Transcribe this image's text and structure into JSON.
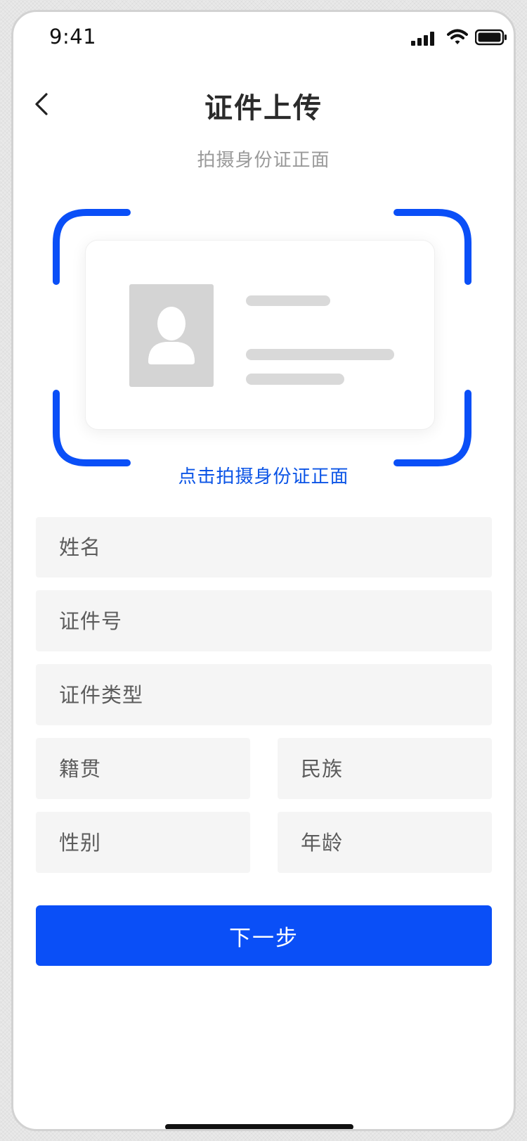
{
  "status_bar": {
    "time": "9:41"
  },
  "header": {
    "title": "证件上传",
    "subtitle": "拍摄身份证正面"
  },
  "scan": {
    "caption": "点击拍摄身份证正面"
  },
  "form": {
    "name_placeholder": "姓名",
    "id_number_placeholder": "证件号",
    "id_type_placeholder": "证件类型",
    "native_place_placeholder": "籍贯",
    "ethnicity_placeholder": "民族",
    "gender_placeholder": "性别",
    "age_placeholder": "年龄"
  },
  "actions": {
    "next_label": "下一步"
  },
  "colors": {
    "accent": "#0a4ff7",
    "caption_blue": "#0b54e6",
    "field_bg": "#f5f5f5",
    "placeholder_gray": "#d4d4d4"
  },
  "icons": {
    "back": "chevron-left-icon",
    "signal": "signal-icon",
    "wifi": "wifi-icon",
    "battery": "battery-icon",
    "avatar": "person-icon"
  }
}
